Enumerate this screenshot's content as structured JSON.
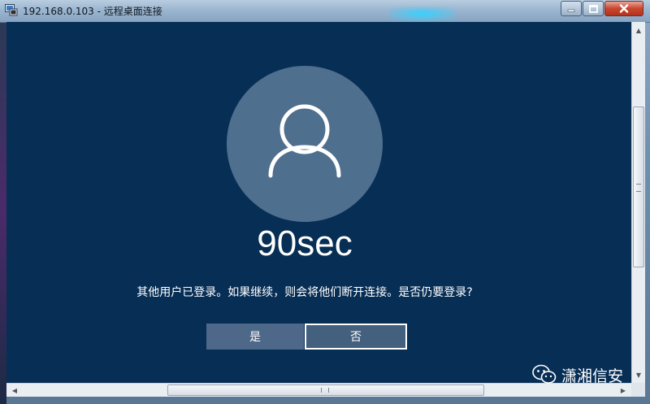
{
  "window": {
    "title": "192.168.0.103 - 远程桌面连接",
    "app_icon": "remote-desktop-icon",
    "controls": {
      "minimize_icon": "minimize-icon",
      "maximize_icon": "maximize-icon",
      "close_icon": "close-icon"
    }
  },
  "login_screen": {
    "avatar_icon": "user-avatar-icon",
    "username": "90sec",
    "prompt": "其他用户已登录。如果继续，则会将他们断开连接。是否仍要登录?",
    "buttons": {
      "yes_label": "是",
      "no_label": "否"
    },
    "background_color": "#072e55",
    "avatar_color": "#4f6f8f"
  },
  "scrollbars": {
    "vertical_position": 0.23,
    "horizontal_position": 0.26
  },
  "watermark": {
    "icon": "wechat-icon",
    "text": "潇湘信安"
  }
}
